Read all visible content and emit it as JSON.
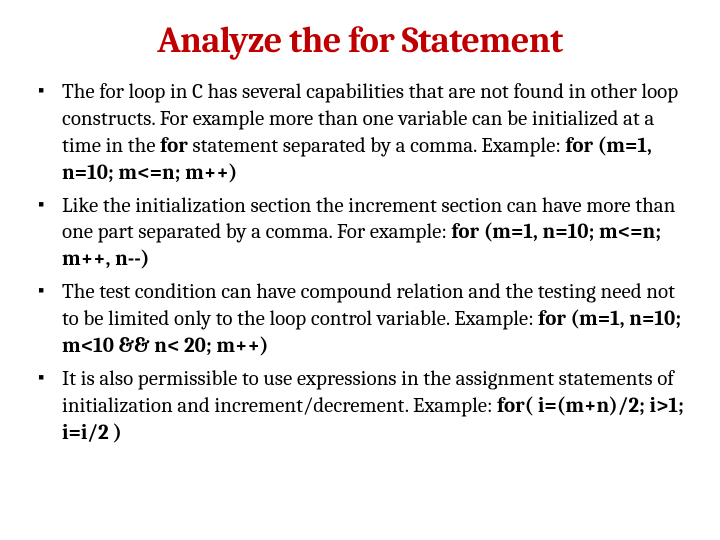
{
  "title": "Analyze the for Statement",
  "bullets": [
    {
      "text_a": "The for loop in C has several capabilities that are not found in other loop constructs. For example more than one variable can be initialized at a time in the ",
      "bold_a": "for",
      "text_b": " statement separated by a comma. Example:    ",
      "bold_b": "for (m=1, n=10; m<=n; m++)"
    },
    {
      "text_a": "Like the initialization section the increment section can have more than one part separated by a comma. For example: ",
      "bold_a": "for (m=1, n=10; m<=n; m++, n--)",
      "text_b": "",
      "bold_b": ""
    },
    {
      "text_a": "The test condition can have compound relation and the testing need not to be limited only to the loop control variable. Example: ",
      "bold_a": "for (m=1, n=10;  m<10 &&  n< 20; m++)",
      "text_b": "",
      "bold_b": ""
    },
    {
      "text_a": "It is also permissible to use expressions in the assignment statements of initialization and increment/decrement. Example: ",
      "bold_a": "for(  i=(m+n)/2;  i>1;  i=i/2   )",
      "text_b": "",
      "bold_b": ""
    }
  ]
}
